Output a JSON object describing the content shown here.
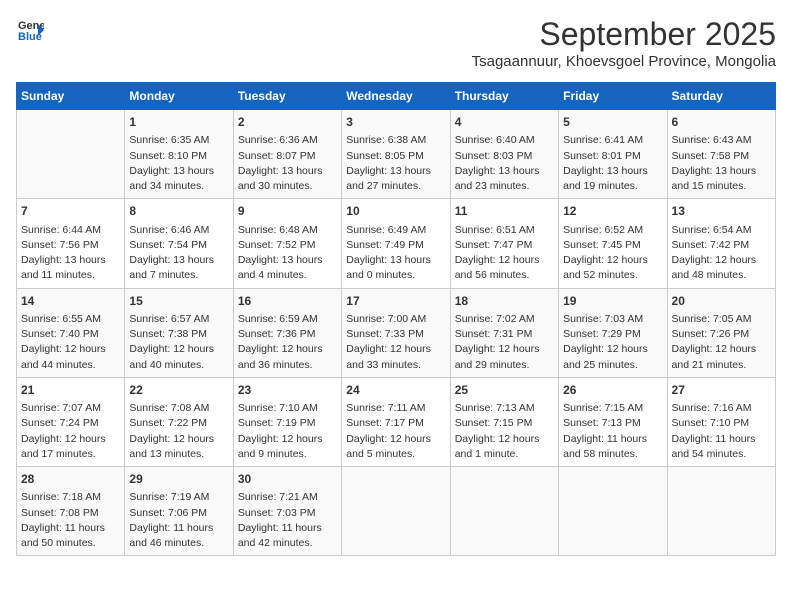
{
  "logo": {
    "line1": "General",
    "line2": "Blue"
  },
  "title": "September 2025",
  "subtitle": "Tsagaannuur, Khoevsgoel Province, Mongolia",
  "headers": [
    "Sunday",
    "Monday",
    "Tuesday",
    "Wednesday",
    "Thursday",
    "Friday",
    "Saturday"
  ],
  "weeks": [
    [
      {
        "day": "",
        "content": ""
      },
      {
        "day": "1",
        "content": "Sunrise: 6:35 AM\nSunset: 8:10 PM\nDaylight: 13 hours\nand 34 minutes."
      },
      {
        "day": "2",
        "content": "Sunrise: 6:36 AM\nSunset: 8:07 PM\nDaylight: 13 hours\nand 30 minutes."
      },
      {
        "day": "3",
        "content": "Sunrise: 6:38 AM\nSunset: 8:05 PM\nDaylight: 13 hours\nand 27 minutes."
      },
      {
        "day": "4",
        "content": "Sunrise: 6:40 AM\nSunset: 8:03 PM\nDaylight: 13 hours\nand 23 minutes."
      },
      {
        "day": "5",
        "content": "Sunrise: 6:41 AM\nSunset: 8:01 PM\nDaylight: 13 hours\nand 19 minutes."
      },
      {
        "day": "6",
        "content": "Sunrise: 6:43 AM\nSunset: 7:58 PM\nDaylight: 13 hours\nand 15 minutes."
      }
    ],
    [
      {
        "day": "7",
        "content": "Sunrise: 6:44 AM\nSunset: 7:56 PM\nDaylight: 13 hours\nand 11 minutes."
      },
      {
        "day": "8",
        "content": "Sunrise: 6:46 AM\nSunset: 7:54 PM\nDaylight: 13 hours\nand 7 minutes."
      },
      {
        "day": "9",
        "content": "Sunrise: 6:48 AM\nSunset: 7:52 PM\nDaylight: 13 hours\nand 4 minutes."
      },
      {
        "day": "10",
        "content": "Sunrise: 6:49 AM\nSunset: 7:49 PM\nDaylight: 13 hours\nand 0 minutes."
      },
      {
        "day": "11",
        "content": "Sunrise: 6:51 AM\nSunset: 7:47 PM\nDaylight: 12 hours\nand 56 minutes."
      },
      {
        "day": "12",
        "content": "Sunrise: 6:52 AM\nSunset: 7:45 PM\nDaylight: 12 hours\nand 52 minutes."
      },
      {
        "day": "13",
        "content": "Sunrise: 6:54 AM\nSunset: 7:42 PM\nDaylight: 12 hours\nand 48 minutes."
      }
    ],
    [
      {
        "day": "14",
        "content": "Sunrise: 6:55 AM\nSunset: 7:40 PM\nDaylight: 12 hours\nand 44 minutes."
      },
      {
        "day": "15",
        "content": "Sunrise: 6:57 AM\nSunset: 7:38 PM\nDaylight: 12 hours\nand 40 minutes."
      },
      {
        "day": "16",
        "content": "Sunrise: 6:59 AM\nSunset: 7:36 PM\nDaylight: 12 hours\nand 36 minutes."
      },
      {
        "day": "17",
        "content": "Sunrise: 7:00 AM\nSunset: 7:33 PM\nDaylight: 12 hours\nand 33 minutes."
      },
      {
        "day": "18",
        "content": "Sunrise: 7:02 AM\nSunset: 7:31 PM\nDaylight: 12 hours\nand 29 minutes."
      },
      {
        "day": "19",
        "content": "Sunrise: 7:03 AM\nSunset: 7:29 PM\nDaylight: 12 hours\nand 25 minutes."
      },
      {
        "day": "20",
        "content": "Sunrise: 7:05 AM\nSunset: 7:26 PM\nDaylight: 12 hours\nand 21 minutes."
      }
    ],
    [
      {
        "day": "21",
        "content": "Sunrise: 7:07 AM\nSunset: 7:24 PM\nDaylight: 12 hours\nand 17 minutes."
      },
      {
        "day": "22",
        "content": "Sunrise: 7:08 AM\nSunset: 7:22 PM\nDaylight: 12 hours\nand 13 minutes."
      },
      {
        "day": "23",
        "content": "Sunrise: 7:10 AM\nSunset: 7:19 PM\nDaylight: 12 hours\nand 9 minutes."
      },
      {
        "day": "24",
        "content": "Sunrise: 7:11 AM\nSunset: 7:17 PM\nDaylight: 12 hours\nand 5 minutes."
      },
      {
        "day": "25",
        "content": "Sunrise: 7:13 AM\nSunset: 7:15 PM\nDaylight: 12 hours\nand 1 minute."
      },
      {
        "day": "26",
        "content": "Sunrise: 7:15 AM\nSunset: 7:13 PM\nDaylight: 11 hours\nand 58 minutes."
      },
      {
        "day": "27",
        "content": "Sunrise: 7:16 AM\nSunset: 7:10 PM\nDaylight: 11 hours\nand 54 minutes."
      }
    ],
    [
      {
        "day": "28",
        "content": "Sunrise: 7:18 AM\nSunset: 7:08 PM\nDaylight: 11 hours\nand 50 minutes."
      },
      {
        "day": "29",
        "content": "Sunrise: 7:19 AM\nSunset: 7:06 PM\nDaylight: 11 hours\nand 46 minutes."
      },
      {
        "day": "30",
        "content": "Sunrise: 7:21 AM\nSunset: 7:03 PM\nDaylight: 11 hours\nand 42 minutes."
      },
      {
        "day": "",
        "content": ""
      },
      {
        "day": "",
        "content": ""
      },
      {
        "day": "",
        "content": ""
      },
      {
        "day": "",
        "content": ""
      }
    ]
  ]
}
